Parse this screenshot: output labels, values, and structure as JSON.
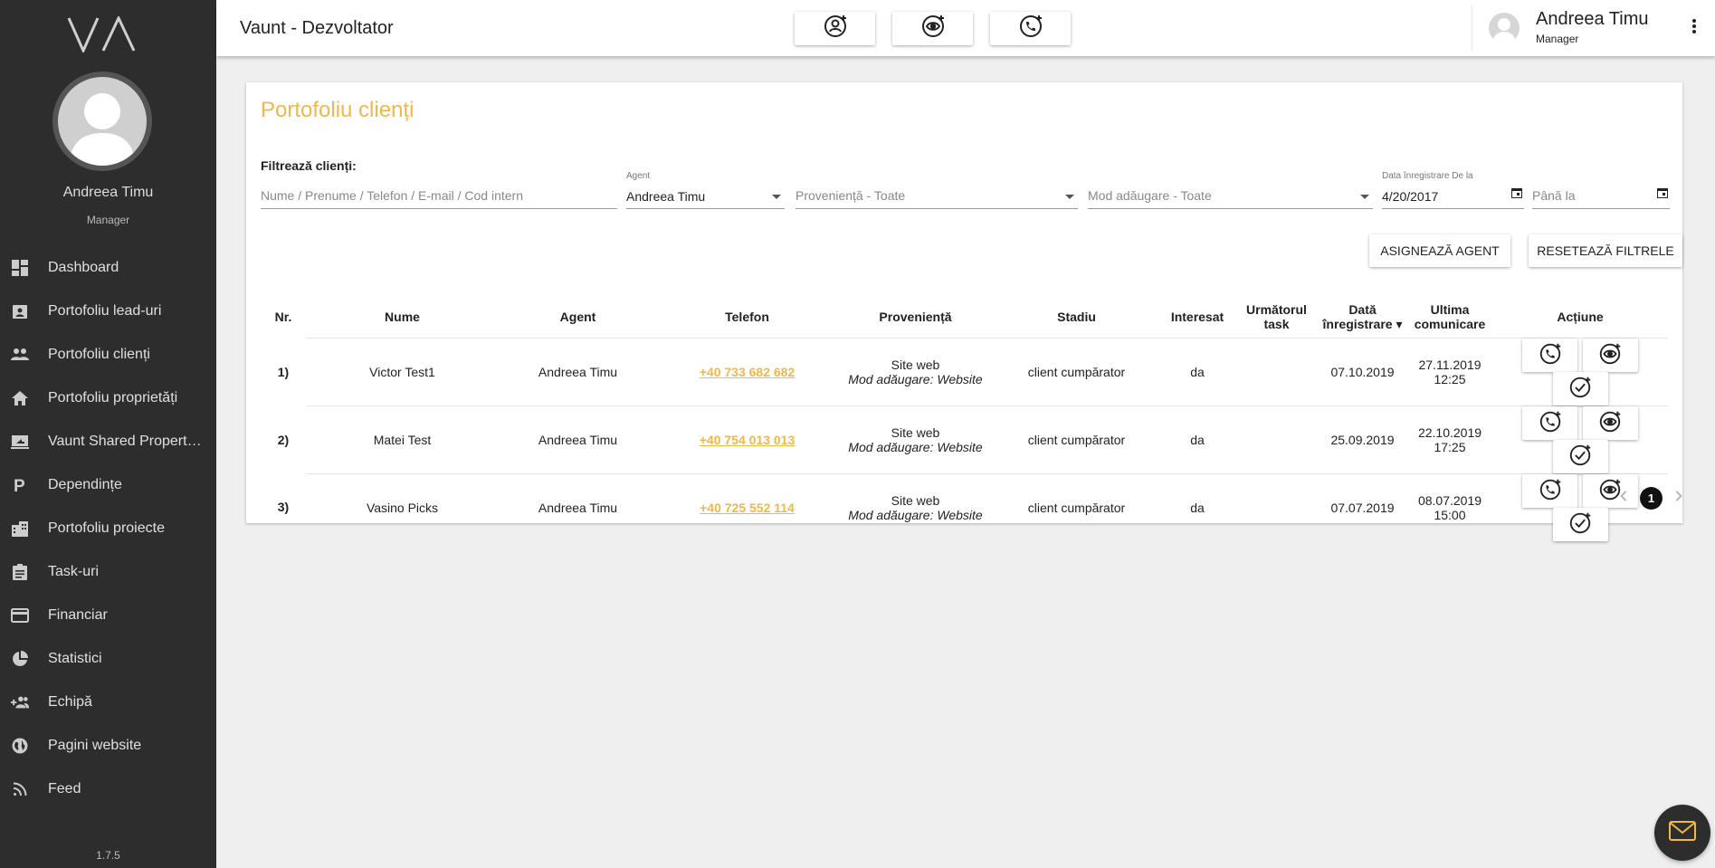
{
  "app": {
    "title": "Vaunt - Dezvoltator",
    "version": "1.7.5"
  },
  "sidebar": {
    "user_name": "Andreea Timu",
    "user_role": "Manager",
    "items": [
      {
        "label": "Dashboard",
        "icon": "dashboard-icon"
      },
      {
        "label": "Portofoliu lead-uri",
        "icon": "contact-card-icon"
      },
      {
        "label": "Portofoliu clienți",
        "icon": "people-icon"
      },
      {
        "label": "Portofoliu proprietăți",
        "icon": "home-icon"
      },
      {
        "label": "Vaunt Shared Properties",
        "icon": "shared-screen-icon"
      },
      {
        "label": "Dependințe",
        "icon": "parking-icon"
      },
      {
        "label": "Portofoliu proiecte",
        "icon": "building-icon"
      },
      {
        "label": "Task-uri",
        "icon": "clipboard-icon"
      },
      {
        "label": "Financiar",
        "icon": "credit-card-icon"
      },
      {
        "label": "Statistici",
        "icon": "pie-chart-icon"
      },
      {
        "label": "Echipă",
        "icon": "add-group-icon"
      },
      {
        "label": "Pagini website",
        "icon": "globe-icon"
      },
      {
        "label": "Feed",
        "icon": "rss-icon"
      }
    ]
  },
  "header": {
    "user_name": "Andreea Timu",
    "user_role": "Manager",
    "actions": [
      "add-contact-icon",
      "eye-add-icon",
      "phone-add-icon"
    ]
  },
  "main": {
    "title": "Portofoliu clienți",
    "filter_label": "Filtrează clienți:",
    "search_placeholder": "Nume / Prenume / Telefon / E-mail / Cod intern",
    "agent_label": "Agent",
    "agent_value": "Andreea Timu",
    "source_placeholder": "Proveniență - Toate",
    "mode_placeholder": "Mod adăugare - Toate",
    "date_from_label": "Data înregistrare De la",
    "date_from_value": "4/20/2017",
    "date_to_placeholder": "Până la",
    "assign_button": "Asignează agent",
    "reset_button": "Resetează filtrele",
    "columns": [
      "Nr.",
      "Nume",
      "Agent",
      "Telefon",
      "Proveniență",
      "Stadiu",
      "Interesat",
      "Următorul task",
      "Dată înregistrare ▾",
      "Ultima comunicare",
      "Acțiune"
    ],
    "rows": [
      {
        "nr": "1)",
        "name": "Victor Test1",
        "agent": "Andreea Timu",
        "phone": "+40 733 682 682",
        "source": "Site web",
        "mode": "Mod adăugare: Website",
        "stage": "client cumpărator",
        "interested": "da",
        "next_task": "",
        "reg_date": "07.10.2019",
        "last_comm_date": "27.11.2019",
        "last_comm_time": "12:25"
      },
      {
        "nr": "2)",
        "name": "Matei Test",
        "agent": "Andreea Timu",
        "phone": "+40 754 013 013",
        "source": "Site web",
        "mode": "Mod adăugare: Website",
        "stage": "client cumpărator",
        "interested": "da",
        "next_task": "",
        "reg_date": "25.09.2019",
        "last_comm_date": "22.10.2019",
        "last_comm_time": "17:25"
      },
      {
        "nr": "3)",
        "name": "Vasino Picks",
        "agent": "Andreea Timu",
        "phone": "+40 725 552 114",
        "source": "Site web",
        "mode": "Mod adăugare: Website",
        "stage": "client cumpărator",
        "interested": "da",
        "next_task": "",
        "reg_date": "07.07.2019",
        "last_comm_date": "08.07.2019",
        "last_comm_time": "15:00"
      }
    ],
    "pagination": {
      "current": "1"
    }
  },
  "colors": {
    "accent": "#f0b74a",
    "sidebar": "#2d2d2d",
    "background": "#efefef"
  }
}
